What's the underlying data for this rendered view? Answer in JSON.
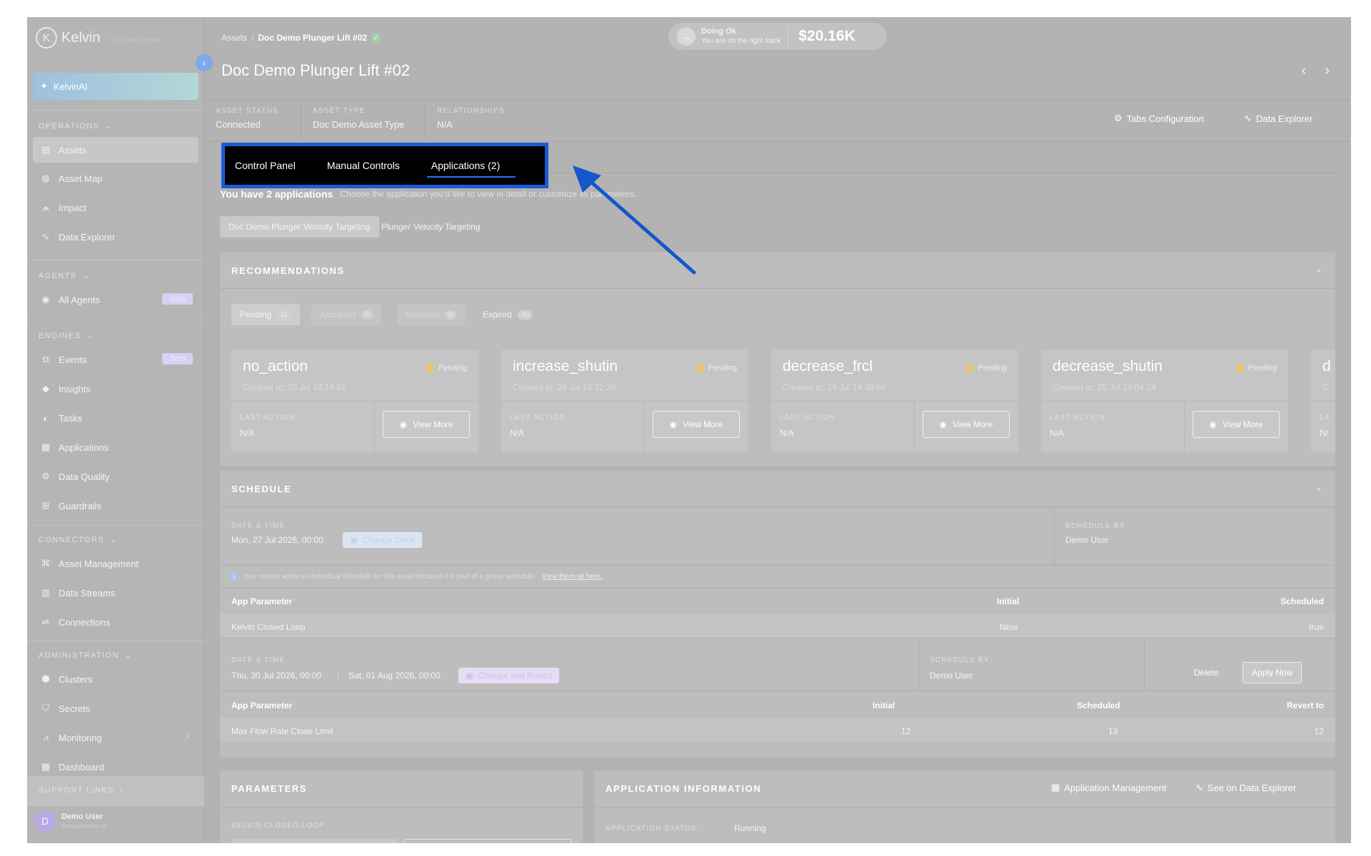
{
  "sidebar": {
    "logo_text": "Kelvin",
    "logo_sub": "Edit Kelvin Edition",
    "kelvinai": "KelvinAI",
    "sections": {
      "operations": "OPERATIONS",
      "agents": "AGENTS",
      "engines": "ENGINES",
      "connectors": "CONNECTORS",
      "administration": "ADMINISTRATION",
      "support": "SUPPORT LINKS"
    },
    "items": {
      "assets": "Assets",
      "asset_map": "Asset Map",
      "impact": "Impact",
      "data_explorer": "Data Explorer",
      "all_agents": "All Agents",
      "events": "Events",
      "insights": "Insights",
      "tasks": "Tasks",
      "applications": "Applications",
      "data_quality": "Data Quality",
      "guardrails": "Guardrails",
      "asset_management": "Asset Management",
      "data_streams": "Data Streams",
      "connections": "Connections",
      "clusters": "Clusters",
      "secrets": "Secrets",
      "monitoring": "Monitoring",
      "dashboard": "Dashboard"
    },
    "beta": "Beta",
    "user": {
      "initial": "D",
      "name": "Demo User",
      "email": "demo@kelvin.ai"
    }
  },
  "header": {
    "breadcrumb_root": "Assets",
    "breadcrumb_current": "Doc Demo Plunger Lift #02",
    "status_title": "Doing Ok",
    "status_sub": "You are on the right track",
    "status_value": "$20.16K",
    "asset_title": "Doc Demo Plunger Lift #02",
    "meta": {
      "status_label": "ASSET STATUS",
      "status_value": "Connected",
      "type_label": "ASSET TYPE",
      "type_value": "Doc Demo Asset Type",
      "rel_label": "RELATIONSHIPS",
      "rel_value": "N/A"
    },
    "tabs_config": "Tabs Configuration",
    "data_explorer": "Data Explorer"
  },
  "tabs": [
    "Control Panel",
    "Manual Controls",
    "Applications (2)"
  ],
  "apps": {
    "heading": "You have 2 applications",
    "hint": "Choose the application you'd like to view in detail or customize its parameters.",
    "app_tabs": [
      "Doc Demo Plunger Velocity Targeting",
      "Plunger Velocity Targeting"
    ]
  },
  "recommendations": {
    "title": "RECOMMENDATIONS",
    "filters": [
      {
        "label": "Pending",
        "count": "11"
      },
      {
        "label": "Accepted",
        "count": "0"
      },
      {
        "label": "Rejected",
        "count": "0"
      },
      {
        "label": "Expired",
        "count": "40"
      }
    ],
    "cards": [
      {
        "name": "no_action",
        "status": "Pending",
        "created": "Created at: 26 Jul 16:14:01",
        "last_label": "LAST ACTION",
        "last_value": "N/A",
        "button": "View More"
      },
      {
        "name": "increase_shutin",
        "status": "Pending",
        "created": "Created at: 26 Jul 15:32:29",
        "last_label": "LAST ACTION",
        "last_value": "N/A",
        "button": "View More"
      },
      {
        "name": "decrease_frcl",
        "status": "Pending",
        "created": "Created at: 26 Jul 14:36:56",
        "last_label": "LAST ACTION",
        "last_value": "N/A",
        "button": "View More"
      },
      {
        "name": "decrease_shutin",
        "status": "Pending",
        "created": "Created at: 26 Jul 14:04:24",
        "last_label": "LAST ACTION",
        "last_value": "N/A",
        "button": "View More"
      },
      {
        "name": "d",
        "status": "",
        "created": "C",
        "last_label": "LA",
        "last_value": "N/",
        "button": ""
      }
    ]
  },
  "schedule": {
    "title": "SCHEDULE",
    "dt_label": "DATE & TIME",
    "by_label": "SCHEDULE BY",
    "first": {
      "date": "Mon, 27 Jul 2026, 00:00",
      "chip": "Change Once",
      "by": "Demo User"
    },
    "note": "You cannot apply an individual schedule for this asset because it is part of a group schedule.",
    "note_link": "View them all here.",
    "table1": {
      "h_param": "App Parameter",
      "h_initial": "Initial",
      "h_sched": "Scheduled",
      "param": "Kelvin Closed Loop",
      "initial": "false",
      "sched": "true"
    },
    "second": {
      "date_start": "Thu, 30 Jul 2026, 00:00",
      "date_end": "Sat, 01 Aug 2026, 00:00",
      "chip": "Change and Revert",
      "by": "Demo User",
      "delete": "Delete",
      "apply": "Apply Now"
    },
    "table2": {
      "h_param": "App Parameter",
      "h_initial": "Initial",
      "h_sched": "Scheduled",
      "h_revert": "Revert to",
      "param": "Max Flow Rate Close Limit",
      "initial": "12",
      "sched": "13",
      "revert": "12"
    }
  },
  "parameters": {
    "title": "PARAMETERS",
    "sub": "KELVIN CLOSED LOOP"
  },
  "app_info": {
    "title": "APPLICATION INFORMATION",
    "mgmt": "Application Management",
    "explorer": "See on Data Explorer",
    "status_label": "APPLICATION STATUS:",
    "status_value": "Running"
  },
  "colors": {
    "highlight": "#1c5bd8",
    "arrow": "#1556c9",
    "overlay_gray": "#b3b3b3"
  }
}
